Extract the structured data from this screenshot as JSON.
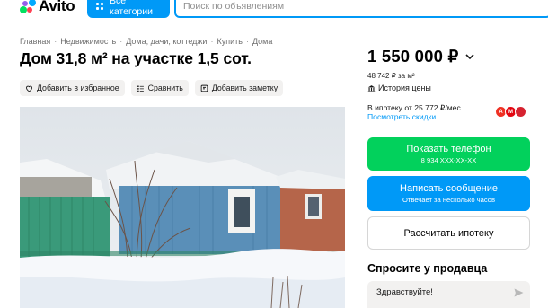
{
  "header": {
    "logo_text": "Avito",
    "categories_button": "Все категории",
    "search_placeholder": "Поиск по объявлениям"
  },
  "breadcrumb": [
    "Главная",
    "Недвижимость",
    "Дома, дачи, коттеджи",
    "Купить",
    "Дома"
  ],
  "listing": {
    "title": "Дом 31,8 м² на участке 1,5 сот."
  },
  "actions": {
    "favorite": "Добавить в избранное",
    "compare": "Сравнить",
    "note": "Добавить заметку"
  },
  "price": {
    "value": "1 550 000 ₽",
    "per_m2": "48 742 ₽ за м²",
    "history_label": "История цены",
    "mortgage_text": "В ипотеку от 25 772 ₽/мес.",
    "discounts_link": "Посмотреть скидки"
  },
  "buttons": {
    "show_phone": "Показать телефон",
    "phone_masked": "8 934 XXX-XX-XX",
    "write_message": "Написать сообщение",
    "response_time": "Отвечает за несколько часов",
    "calc_mortgage": "Рассчитать ипотеку"
  },
  "seller_chat": {
    "heading": "Спросите у продавца",
    "message_value": "Здравствуйте!"
  },
  "colors": {
    "accent_blue": "#0099f7",
    "green": "#02d15c",
    "chip_bg": "#f2f1f0"
  },
  "icons": [
    "avito-logo-icon",
    "categories-grid-icon",
    "heart-icon",
    "compare-icon",
    "note-icon",
    "chevron-down-icon",
    "bank-icon",
    "send-icon"
  ]
}
